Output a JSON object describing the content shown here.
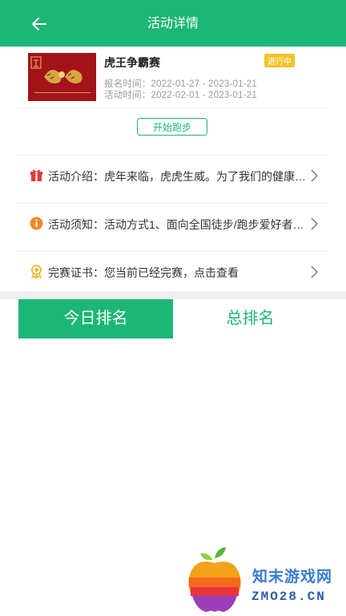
{
  "header": {
    "title": "活动详情",
    "back_icon": "arrow-left-icon"
  },
  "event": {
    "name": "虎王争霸赛",
    "status": "进行中",
    "signup_label": "报名时间：",
    "signup_range": "2022-01-27 - 2023-01-21",
    "activity_label": "活动时间：",
    "activity_range": "2022-02-01 - 2023-01-21",
    "thumbnail_caption": "虎年争如意"
  },
  "start_button": "开始跑步",
  "rows": [
    {
      "icon": "gift-icon",
      "text": "活动介绍：虎年来临，虎虎生威。为了我们的健康…"
    },
    {
      "icon": "info-icon",
      "text": "活动须知：活动方式1、面向全国徒步/跑步爱好者…"
    },
    {
      "icon": "certificate-icon",
      "text": "完赛证书：您当前已经完赛，点击查看"
    }
  ],
  "tabs": {
    "today": "今日排名",
    "total": "总排名"
  },
  "watermark": {
    "title": "知末游戏网",
    "domain": "ZMO28.CN"
  },
  "colors": {
    "brand_green": "#1cb677",
    "badge_yellow": "#f5c32c",
    "gift_red": "#e0393e",
    "info_orange": "#f08a24",
    "cert_yellow": "#f2b632"
  }
}
